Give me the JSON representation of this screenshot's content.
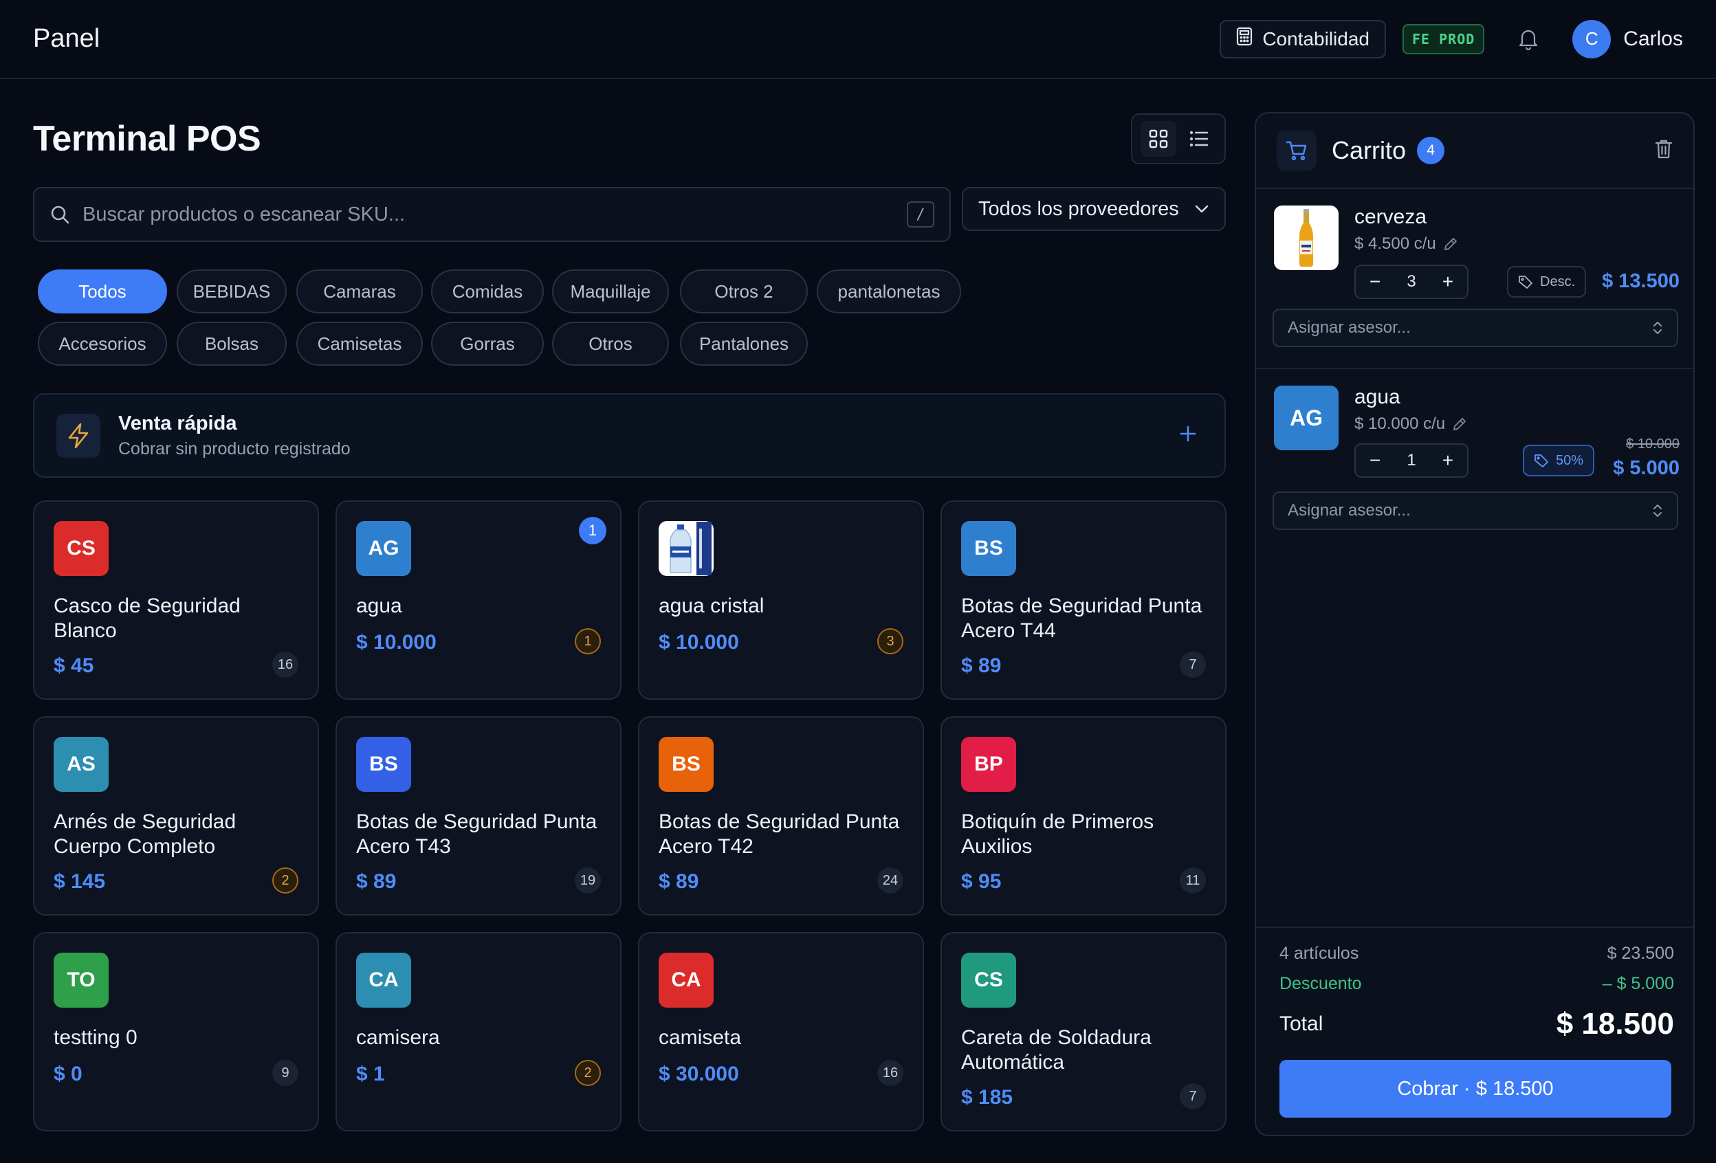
{
  "header": {
    "brand": "Panel",
    "accounting_label": "Contabilidad",
    "env_badge": "FE PROD",
    "user_initial": "C",
    "user_name": "Carlos"
  },
  "page": {
    "title": "Terminal POS",
    "search_placeholder": "Buscar productos o escanear SKU...",
    "search_shortcut": "/",
    "provider_filter": "Todos los proveedores"
  },
  "categories": [
    "Todos",
    "BEBIDAS",
    "Camaras",
    "Comidas",
    "Maquillaje",
    "Otros 2",
    "pantalonetas",
    "Accesorios",
    "Bolsas",
    "Camisetas",
    "Gorras",
    "Otros",
    "Pantalones"
  ],
  "active_category": "Todos",
  "quick_sale": {
    "title": "Venta rápida",
    "subtitle": "Cobrar sin producto registrado"
  },
  "products": [
    {
      "initials": "CS",
      "name": "Casco de Seguridad Blanco",
      "price": "$ 45",
      "stock": "16",
      "low_stock": false,
      "color": "#dc2b2b"
    },
    {
      "initials": "AG",
      "name": "agua",
      "price": "$ 10.000",
      "stock": "1",
      "low_stock": true,
      "color": "#2f7fcf",
      "in_cart": "1"
    },
    {
      "initials": "",
      "name": "agua cristal",
      "price": "$ 10.000",
      "stock": "3",
      "low_stock": true,
      "color": "#ffffff",
      "image": "water-bottle"
    },
    {
      "initials": "BS",
      "name": "Botas de Seguridad Punta Acero T44",
      "price": "$ 89",
      "stock": "7",
      "low_stock": false,
      "color": "#2f7fcf"
    },
    {
      "initials": "AS",
      "name": "Arnés de Seguridad Cuerpo Completo",
      "price": "$ 145",
      "stock": "2",
      "low_stock": true,
      "color": "#2c8fb1"
    },
    {
      "initials": "BS",
      "name": "Botas de Seguridad Punta Acero T43",
      "price": "$ 89",
      "stock": "19",
      "low_stock": false,
      "color": "#3460e8"
    },
    {
      "initials": "BS",
      "name": "Botas de Seguridad Punta Acero T42",
      "price": "$ 89",
      "stock": "24",
      "low_stock": false,
      "color": "#e8620c"
    },
    {
      "initials": "BP",
      "name": "Botiquín de Primeros Auxilios",
      "price": "$ 95",
      "stock": "11",
      "low_stock": false,
      "color": "#e11d48"
    },
    {
      "initials": "TO",
      "name": "testting 0",
      "price": "$ 0",
      "stock": "9",
      "low_stock": false,
      "color": "#2ea049"
    },
    {
      "initials": "CA",
      "name": "camisera",
      "price": "$ 1",
      "stock": "2",
      "low_stock": true,
      "color": "#2c8fb1"
    },
    {
      "initials": "CA",
      "name": "camiseta",
      "price": "$ 30.000",
      "stock": "16",
      "low_stock": false,
      "color": "#dc2b2b"
    },
    {
      "initials": "CS",
      "name": "Careta de Soldadura Automática",
      "price": "$ 185",
      "stock": "7",
      "low_stock": false,
      "color": "#1f9a7d"
    }
  ],
  "cart": {
    "title": "Carrito",
    "count": "4",
    "items": [
      {
        "name": "cerveza",
        "unit_price": "$ 4.500 c/u",
        "qty": "3",
        "discount_label": "Desc.",
        "total": "$ 13.500",
        "original": "",
        "thumb": "beer-bottle",
        "advisor_placeholder": "Asignar asesor..."
      },
      {
        "name": "agua",
        "unit_price": "$ 10.000 c/u",
        "qty": "1",
        "discount_label": "50%",
        "total": "$ 5.000",
        "original": "$ 10.000",
        "thumb_initials": "AG",
        "thumb_color": "#2f7fcf",
        "advisor_placeholder": "Asignar asesor..."
      }
    ],
    "summary": {
      "items_label": "4 artículos",
      "subtotal": "$ 23.500",
      "discount_label": "Descuento",
      "discount_value": "– $ 5.000",
      "total_label": "Total",
      "total_value": "$ 18.500",
      "pay_label": "Cobrar · $ 18.500"
    }
  },
  "colors": {
    "accent": "#3e7bf6",
    "price": "#4f8cf7",
    "discount": "#3fc48a",
    "warn": "#e9a53c"
  }
}
